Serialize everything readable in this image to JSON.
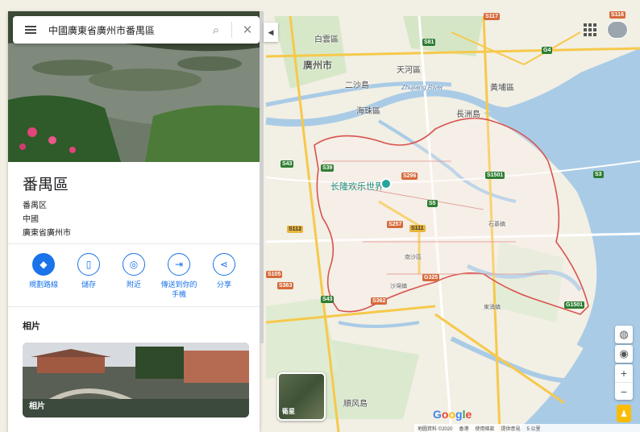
{
  "search": {
    "query": "中國廣東省廣州市番禺區",
    "search_icon": "search-icon",
    "close_icon": "close-icon"
  },
  "place": {
    "title": "番禺區",
    "line1": "番禺区",
    "line2": "中國",
    "line3": "廣東省廣州市"
  },
  "actions": [
    {
      "label": "規劃路線",
      "icon": "directions-icon"
    },
    {
      "label": "儲存",
      "icon": "bookmark-icon"
    },
    {
      "label": "附近",
      "icon": "nearby-icon"
    },
    {
      "label": "傳送到你的\n手機",
      "icon": "send-to-phone-icon"
    },
    {
      "label": "分享",
      "icon": "share-icon"
    }
  ],
  "photos": {
    "heading": "相片",
    "card_label": "相片"
  },
  "map": {
    "labels": {
      "city": "廣州市",
      "baiyun": "白雲區",
      "tianhe": "天河區",
      "ersha": "二沙島",
      "zhuhai": "海珠區",
      "huangpu": "黃埔區",
      "changzhou": "長洲島",
      "shunfeng": "順风島",
      "shiqi": "石碁鎮",
      "shawan": "沙灣鎮",
      "dongchong": "東涌鎮",
      "nansha": "南沙區",
      "river": "Zhujiang River"
    },
    "poi": "长隆欢乐世界",
    "satellite_label": "衛星",
    "badges": [
      "S81",
      "S39",
      "S296",
      "S1501",
      "S43",
      "S5",
      "S112",
      "S257",
      "S111",
      "S105",
      "S363",
      "G325",
      "S362",
      "G1501",
      "S3",
      "G4",
      "S117",
      "S116",
      "S43"
    ],
    "footer": {
      "data": "地圖資料 ©2020",
      "region": "香港",
      "terms": "使用條款",
      "feedback": "提供意見",
      "scale": "5 公里"
    }
  },
  "colors": {
    "accent": "#1a73e8",
    "boundary": "#d9534f",
    "water": "#9fc5e0",
    "land": "#f3f0e6",
    "green": "#cfe5c0"
  }
}
